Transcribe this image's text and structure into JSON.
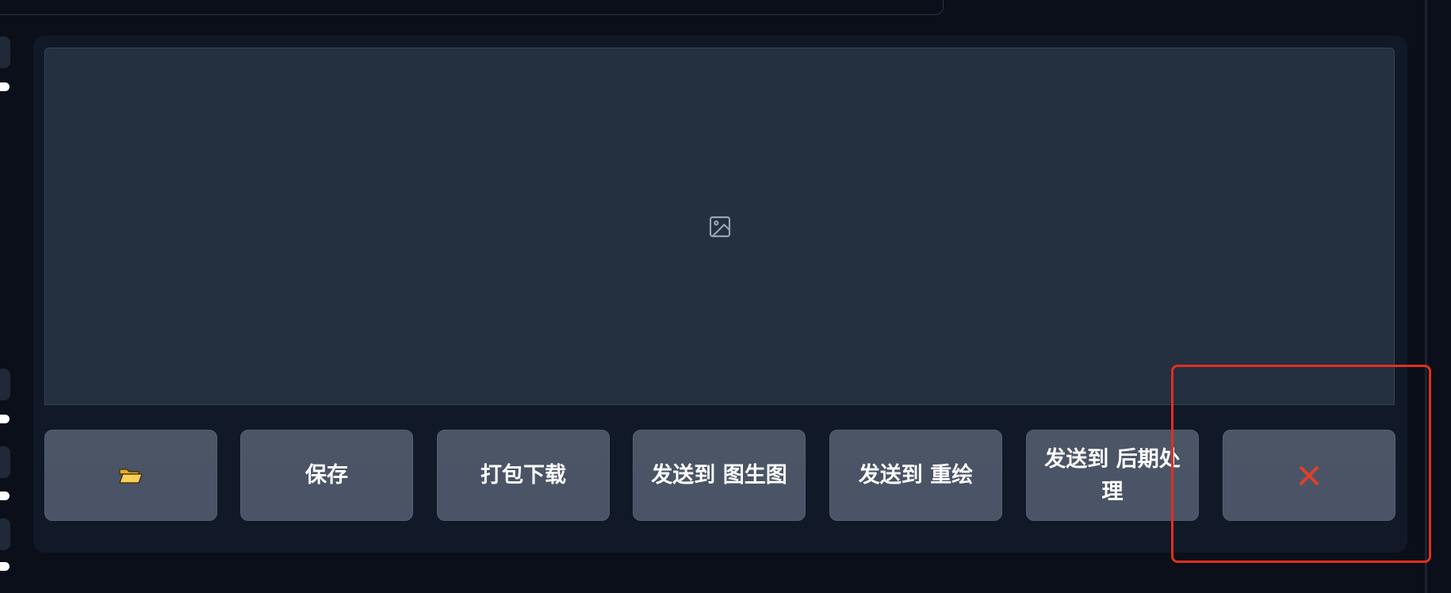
{
  "gallery": {
    "empty_image_icon": "image-placeholder-icon"
  },
  "actions": {
    "open_folder": {
      "icon": "folder-icon"
    },
    "save": {
      "label": "保存"
    },
    "zip_download": {
      "label": "打包下载"
    },
    "send_to_img2img": {
      "label": "发送到 图生图"
    },
    "send_to_inpaint": {
      "label": "发送到 重绘"
    },
    "send_to_extras": {
      "label": "发送到 后期处理"
    },
    "clear": {
      "icon": "close-icon",
      "color": "#e0402a"
    }
  },
  "colors": {
    "page_bg": "#0b0f19",
    "panel_bg": "#111827",
    "image_area_bg": "#242f40",
    "button_bg": "#4b5563",
    "highlight": "#e0301e"
  }
}
